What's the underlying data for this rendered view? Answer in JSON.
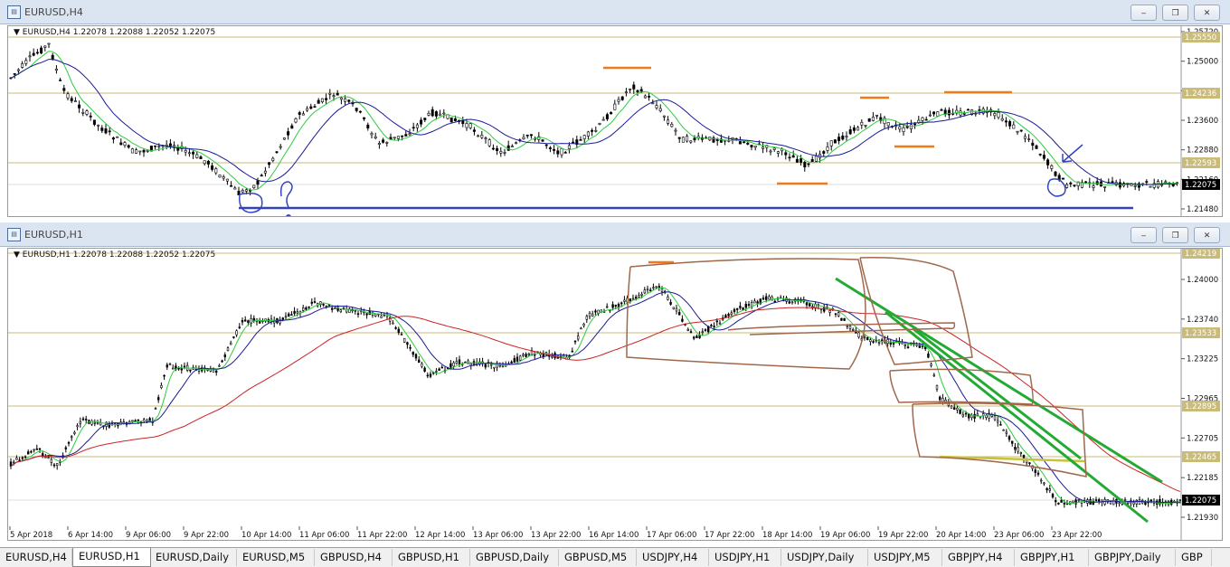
{
  "windows": [
    {
      "title": "EURUSD,H4",
      "ohlc": "EURUSD,H4  1.22078 1.22088 1.22052 1.22075",
      "price_labels": [
        "1.25720",
        "1.25000",
        "1.24280",
        "1.23600",
        "1.22880",
        "1.22160",
        "1.21480"
      ],
      "hlines": [
        {
          "label": "1.25550",
          "color": "#c9bb7a"
        },
        {
          "label": "1.24236",
          "color": "#c9bb7a"
        },
        {
          "label": "1.22593",
          "color": "#c9bb7a"
        },
        {
          "label": "1.22075",
          "color": "#000000"
        }
      ],
      "time_labels": []
    },
    {
      "title": "EURUSD,H1",
      "ohlc": "EURUSD,H1  1.22078 1.22088 1.22052 1.22075",
      "price_labels": [
        "1.24000",
        "1.23740",
        "1.23225",
        "1.22965",
        "1.22705",
        "1.22185",
        "1.21930"
      ],
      "hlines": [
        {
          "label": "1.24219",
          "color": "#c9bb7a"
        },
        {
          "label": "1.23533",
          "color": "#c9bb7a"
        },
        {
          "label": "1.22895",
          "color": "#c9bb7a"
        },
        {
          "label": "1.22465",
          "color": "#c9bb7a"
        },
        {
          "label": "1.22075",
          "color": "#000000"
        }
      ],
      "time_labels": [
        "5 Apr 2018",
        "6 Apr 14:00",
        "9 Apr 06:00",
        "9 Apr 22:00",
        "10 Apr 14:00",
        "11 Apr 06:00",
        "11 Apr 22:00",
        "12 Apr 14:00",
        "13 Apr 06:00",
        "13 Apr 22:00",
        "16 Apr 14:00",
        "17 Apr 06:00",
        "17 Apr 22:00",
        "18 Apr 14:00",
        "19 Apr 06:00",
        "19 Apr 22:00",
        "20 Apr 14:00",
        "23 Apr 06:00",
        "23 Apr 22:00"
      ]
    }
  ],
  "window_buttons": {
    "minimize": "–",
    "restore": "❐",
    "close": "✕"
  },
  "tabs": [
    "EURUSD,H4",
    "EURUSD,H1",
    "EURUSD,Daily",
    "EURUSD,M5",
    "GBPUSD,H4",
    "GBPUSD,H1",
    "GBPUSD,Daily",
    "GBPUSD,M5",
    "USDJPY,H4",
    "USDJPY,H1",
    "USDJPY,Daily",
    "USDJPY,M5",
    "GBPJPY,H4",
    "GBPJPY,H1",
    "GBPJPY,Daily",
    "GBP"
  ],
  "active_tab": 1,
  "colors": {
    "candle": "#000000",
    "ma_fast": "#2ecc40",
    "ma_mid": "#1a1a99",
    "ma_slow": "#cc2222",
    "level": "#c9bb7a",
    "orange": "#f07a1a",
    "blue_drawing": "#3344bb",
    "brown_drawing": "#a0674b",
    "green_trend": "#22aa33",
    "current_price_bg": "#000000"
  }
}
